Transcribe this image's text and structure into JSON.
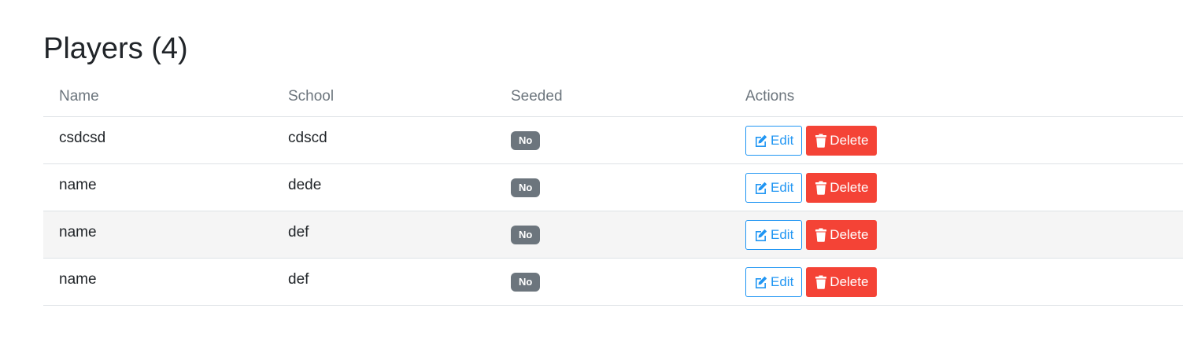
{
  "page": {
    "title": "Players (4)"
  },
  "table": {
    "columns": [
      "Name",
      "School",
      "Seeded",
      "Actions"
    ],
    "rows": [
      {
        "name": "csdcsd",
        "school": "cdscd",
        "seeded": "No"
      },
      {
        "name": "name",
        "school": "dede",
        "seeded": "No"
      },
      {
        "name": "name",
        "school": "def",
        "seeded": "No"
      },
      {
        "name": "name",
        "school": "def",
        "seeded": "No"
      }
    ]
  },
  "actions": {
    "edit_label": "Edit",
    "delete_label": "Delete",
    "edit_icon": "edit-icon",
    "delete_icon": "trash-icon"
  },
  "colors": {
    "edit": "#2196f3",
    "delete": "#f44336",
    "badge": "#6c757d",
    "striped_row": "#f5f5f5"
  }
}
